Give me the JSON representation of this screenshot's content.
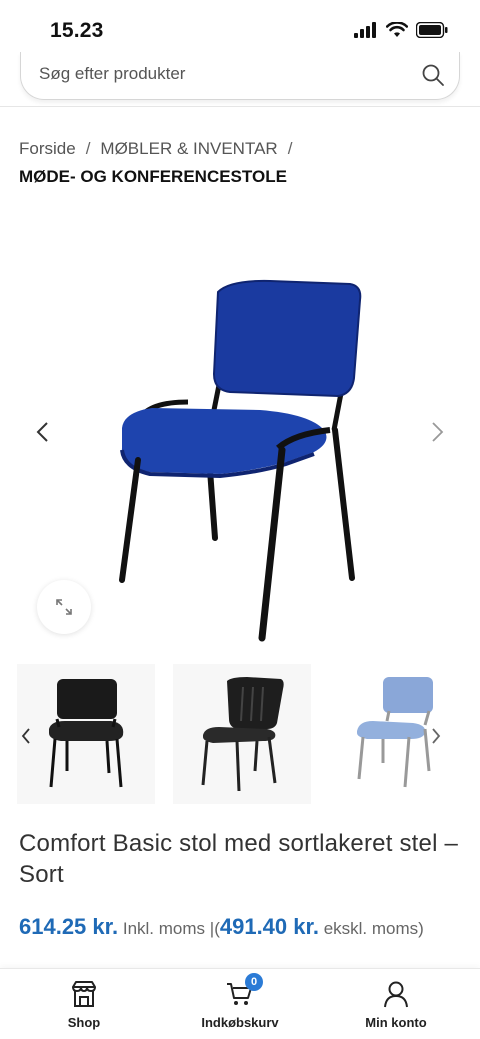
{
  "status_bar": {
    "time": "15.23"
  },
  "search": {
    "placeholder": "Søg efter produkter"
  },
  "breadcrumb": {
    "items": [
      "Forside",
      "MØBLER & INVENTAR"
    ],
    "current": "MØDE- OG KONFERENCESTOLE",
    "separator": "/"
  },
  "product": {
    "title": "Comfort Basic stol med sortlakeret stel – Sort",
    "price_incl": "614.25 kr.",
    "price_incl_label": "Inkl. moms",
    "price_divider": "|",
    "price_open": "(",
    "price_excl": "491.40 kr.",
    "price_excl_label": "ekskl. moms)",
    "main_image_color": "#1a3aa0",
    "thumbnails": [
      {
        "name": "black-chair",
        "color": "#1a1a1a"
      },
      {
        "name": "black-plastic-chair",
        "color": "#222222"
      },
      {
        "name": "light-blue-chair",
        "color": "#8aa7d8"
      }
    ]
  },
  "bottom_nav": {
    "shop": "Shop",
    "cart": "Indkøbskurv",
    "cart_count": "0",
    "account": "Min konto"
  },
  "colors": {
    "accent": "#1f6ab6",
    "badge": "#2b7bd6"
  }
}
